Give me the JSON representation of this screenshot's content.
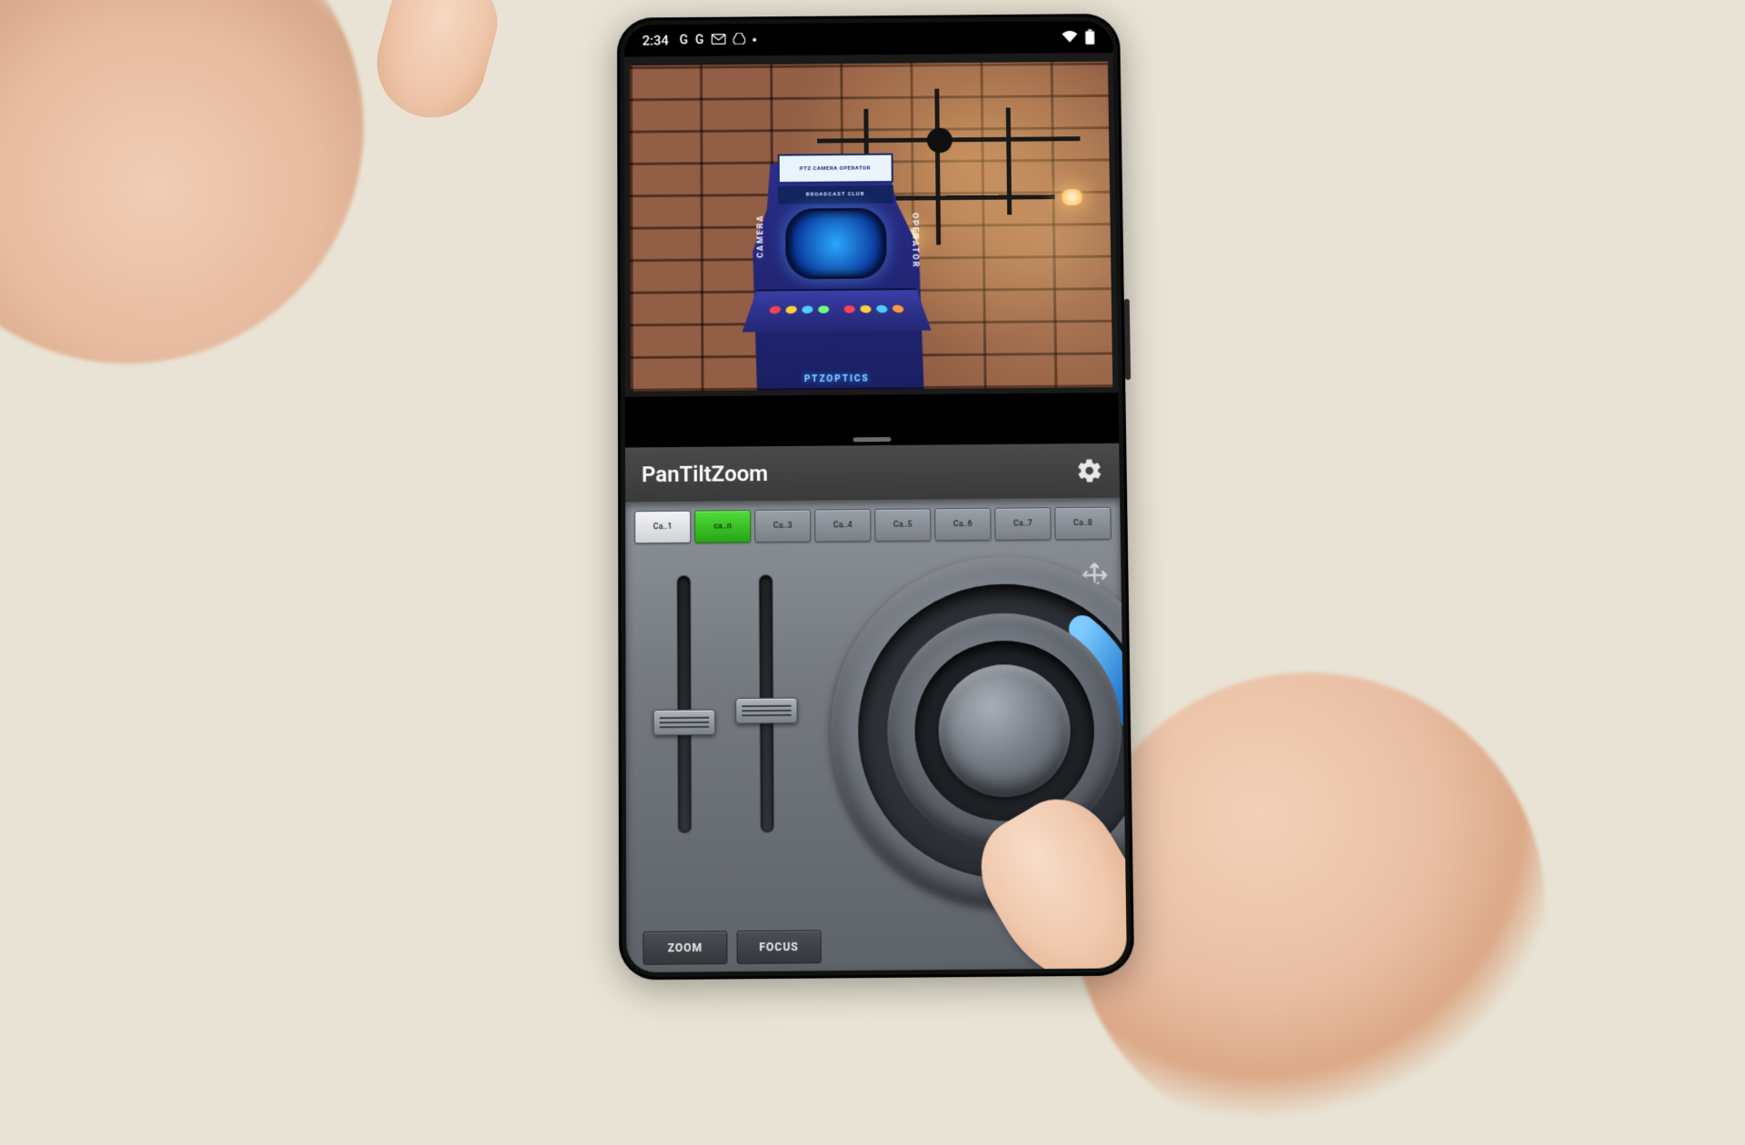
{
  "statusbar": {
    "time": "2:34",
    "left_icons": [
      "G",
      "G",
      "mail-icon",
      "drive-icon"
    ],
    "right_icons": [
      "wifi-icon",
      "battery-icon"
    ]
  },
  "preview": {
    "arcade": {
      "marquee": "PTZ CAMERA OPERATOR",
      "header": "BROADCAST CLUB",
      "side_left": "CAMERA",
      "side_right": "OPERATOR",
      "brand": "PTZOPTICS"
    }
  },
  "panel": {
    "title": "PanTiltZoom",
    "cameras": [
      {
        "label": "Ca..1",
        "state": "white"
      },
      {
        "label": "ca..n",
        "state": "active"
      },
      {
        "label": "Ca..3",
        "state": "normal"
      },
      {
        "label": "Ca..4",
        "state": "normal"
      },
      {
        "label": "Ca..5",
        "state": "normal"
      },
      {
        "label": "Ca..6",
        "state": "normal"
      },
      {
        "label": "Ca..7",
        "state": "normal"
      },
      {
        "label": "Ca..8",
        "state": "normal"
      }
    ],
    "sliders": {
      "zoom": {
        "label": "ZOOM"
      },
      "focus": {
        "label": "FOCUS"
      }
    },
    "joystick": {
      "direction_indicator_deg": 30
    }
  }
}
